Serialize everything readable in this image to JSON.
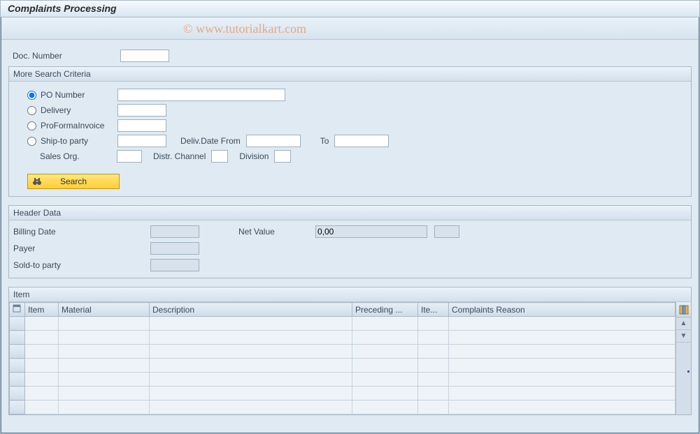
{
  "title": "Complaints Processing",
  "watermark": "© www.tutorialkart.com",
  "doc_number_label": "Doc. Number",
  "doc_number_value": "",
  "search_group": {
    "title": "More Search Criteria",
    "po_number": {
      "label": "PO Number",
      "value": "",
      "selected": true
    },
    "delivery": {
      "label": "Delivery",
      "value": "",
      "selected": false
    },
    "proforma": {
      "label": "ProFormaInvoice",
      "value": "",
      "selected": false
    },
    "shipto": {
      "label": "Ship-to party",
      "value": "",
      "selected": false
    },
    "deliv_date_from_label": "Deliv.Date From",
    "deliv_date_from_value": "",
    "deliv_date_to_label": "To",
    "deliv_date_to_value": "",
    "sales_org_label": "Sales Org.",
    "sales_org_value": "",
    "distr_channel_label": "Distr. Channel",
    "distr_channel_value": "",
    "division_label": "Division",
    "division_value": "",
    "search_button": "Search"
  },
  "header_data": {
    "title": "Header Data",
    "billing_date_label": "Billing Date",
    "billing_date_value": "",
    "net_value_label": "Net Value",
    "net_value_value": "0,00",
    "net_value_curr": "",
    "payer_label": "Payer",
    "payer_value": "",
    "soldto_label": "Sold-to party",
    "soldto_value": ""
  },
  "item_grid": {
    "title": "Item",
    "columns": [
      "Item",
      "Material",
      "Description",
      "Preceding ...",
      "Ite...",
      "Complaints Reason"
    ],
    "rows": 7
  }
}
